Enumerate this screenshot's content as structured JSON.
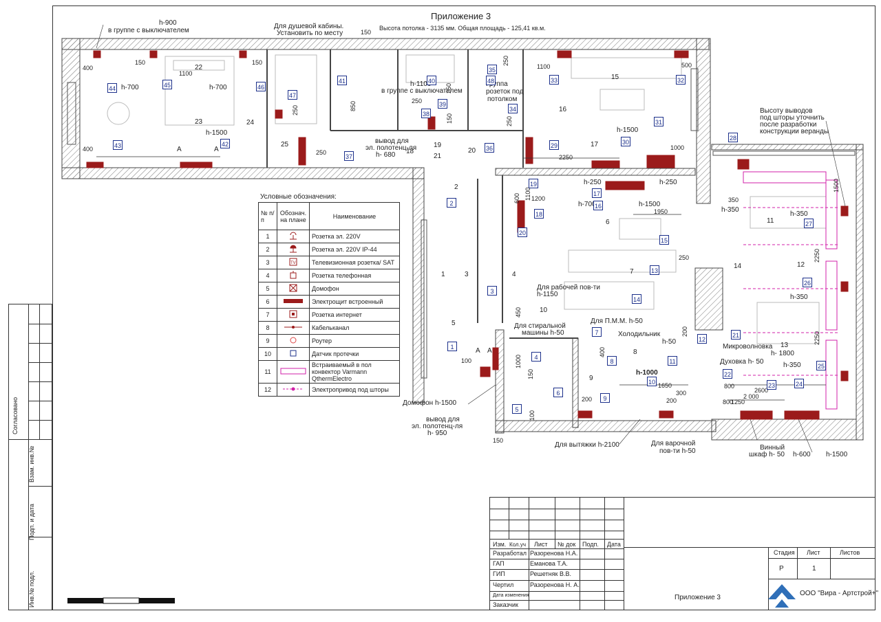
{
  "header": {
    "title": "Приложение 3",
    "subtitle": "Высота потолка - 3135 мм. Общая площадь - 125,41 кв.м."
  },
  "notes": {
    "h900": "h-900",
    "switch_group_1": "в группе с выключателем",
    "shower": "Для душевой кабины.",
    "shower2": "Установить по месту",
    "switch_group_2": "в группе с выключателем",
    "h1100": "h-1100",
    "group_ceiling_1": "Группа",
    "group_ceiling_2": "розеток под",
    "group_ceiling_3": "потолком",
    "veranda_1": "Высоту выводов",
    "veranda_2": "под шторы уточнить",
    "veranda_3": "после разработки",
    "veranda_4": "конструкции веранды",
    "towel1_1": "вывод для",
    "towel1_2": "эл. полотенц-ля",
    "towel1_3": "h- 680",
    "work_surface": "Для рабочей пов-ти",
    "h1150": "h-1150",
    "washer_1": "Для стиральной",
    "washer_2": "машины h-50",
    "pmm": "Для П.М.М. h-50",
    "fridge_1": "Холодильник",
    "fridge_2": "h-50",
    "microwave_1": "Микроволновка",
    "microwave_2": "h- 1800",
    "oven": "Духовка h- 50",
    "intercom": "Домофон h-1500",
    "towel2_1": "вывод для",
    "towel2_2": "эл. полотенц-ля",
    "towel2_3": "h- 950",
    "hood": "Для вытяжки h-2100",
    "hob_1": "Для варочной",
    "hob_2": "пов-ти h-50",
    "wine_1": "Винный",
    "wine_2": "шкаф h- 50",
    "h600": "h-600",
    "h1500": "h-1500",
    "h1000": "h-1000"
  },
  "dims": [
    "400",
    "150",
    "400",
    "150",
    "250",
    "1100",
    "850",
    "250",
    "150",
    "250",
    "1100",
    "500",
    "250",
    "250",
    "2250",
    "1000",
    "1200",
    "1950",
    "350",
    "1500",
    "2250",
    "2250",
    "600",
    "1100",
    "250",
    "450",
    "1000",
    "150",
    "100",
    "200",
    "400",
    "200",
    "1650",
    "300",
    "800",
    "200",
    "800",
    "2600",
    "2 000",
    "1250",
    "100",
    "150",
    "250",
    "150"
  ],
  "heights": [
    "h-700",
    "h-700",
    "h-1500",
    "h-1500",
    "h-250",
    "h-250",
    "h-700",
    "h-1500",
    "h-350",
    "h-350",
    "h-350",
    "h-350"
  ],
  "rooms": [
    "1",
    "2",
    "3",
    "4",
    "5",
    "6",
    "7",
    "8",
    "9",
    "10",
    "11",
    "12",
    "13",
    "14",
    "15",
    "16",
    "17",
    "18",
    "19",
    "20",
    "21",
    "22",
    "23",
    "24",
    "25"
  ],
  "markers": [
    "1",
    "2",
    "3",
    "4",
    "5",
    "6",
    "7",
    "8",
    "9",
    "10",
    "11",
    "12",
    "13",
    "14",
    "15",
    "16",
    "17",
    "18",
    "19",
    "20",
    "21",
    "22",
    "23",
    "24",
    "25",
    "26",
    "27",
    "28",
    "29",
    "30",
    "31",
    "32",
    "33",
    "34",
    "35",
    "36",
    "37",
    "38",
    "39",
    "40",
    "41",
    "42",
    "43",
    "44",
    "45",
    "46",
    "47",
    "48"
  ],
  "axis_letters": [
    "A",
    "A",
    "A",
    "A"
  ],
  "legend": {
    "title": "Условные обозначения:",
    "col_no": "№ п/п",
    "col_sym_1": "Обознач.",
    "col_sym_2": "на плане",
    "col_name": "Наименование",
    "rows": [
      {
        "no": "1",
        "name": "Розетка эл. 220V",
        "sym": "socket"
      },
      {
        "no": "2",
        "name": "Розетка эл. 220V  IP-44",
        "sym": "socket-ip"
      },
      {
        "no": "3",
        "name": "Телевизионная розетка/ SAT",
        "sym": "tv"
      },
      {
        "no": "4",
        "name": "Розетка    телефонная",
        "sym": "phone"
      },
      {
        "no": "5",
        "name": "Домофон",
        "sym": "intercom"
      },
      {
        "no": "6",
        "name": "Электрощит встроенный",
        "sym": "panel"
      },
      {
        "no": "7",
        "name": "Розетка интернет",
        "sym": "net"
      },
      {
        "no": "8",
        "name": "Кабельканал",
        "sym": "cable"
      },
      {
        "no": "9",
        "name": "Роутер",
        "sym": "router"
      },
      {
        "no": "10",
        "name": "Датчик протечки",
        "sym": "leak"
      },
      {
        "no": "11",
        "name": "Встраиваемый в пол конвектор Varmann QthermElectro",
        "sym": "convector"
      },
      {
        "no": "12",
        "name": "Электропривод под шторы",
        "sym": "drive"
      }
    ]
  },
  "side_stamp": [
    "Согласовано",
    "Взам. инв.№",
    "Подп. и дата",
    "Инв.№ подл."
  ],
  "stamp": {
    "head": [
      "Изм.",
      "Кол.уч",
      "Лист",
      "№ док",
      "Подп.",
      "Дата"
    ],
    "roles": [
      {
        "role": "Разработал",
        "name": "Разоренова Н.А."
      },
      {
        "role": "ГАП",
        "name": "Еманова Т.А."
      },
      {
        "role": "ГИП",
        "name": "Решетняк В.В."
      },
      {
        "role": "Чертил",
        "name": "Разоренова Н. А."
      },
      {
        "role": "Дата изменения",
        "name": ""
      },
      {
        "role": "Заказчик",
        "name": ""
      }
    ],
    "stage_head": "Стадия",
    "sheet_head": "Лист",
    "sheets_head": "Листов",
    "stage": "Р",
    "sheet": "1",
    "sheets": "",
    "doc_title": "Приложение 3",
    "company": "ООО \"Вира - Артстрой+\""
  },
  "colors": {
    "wall": "#555555",
    "accent": "#9b1b1b",
    "marker": "#1b2f8a",
    "pink": "#d21fa8"
  }
}
